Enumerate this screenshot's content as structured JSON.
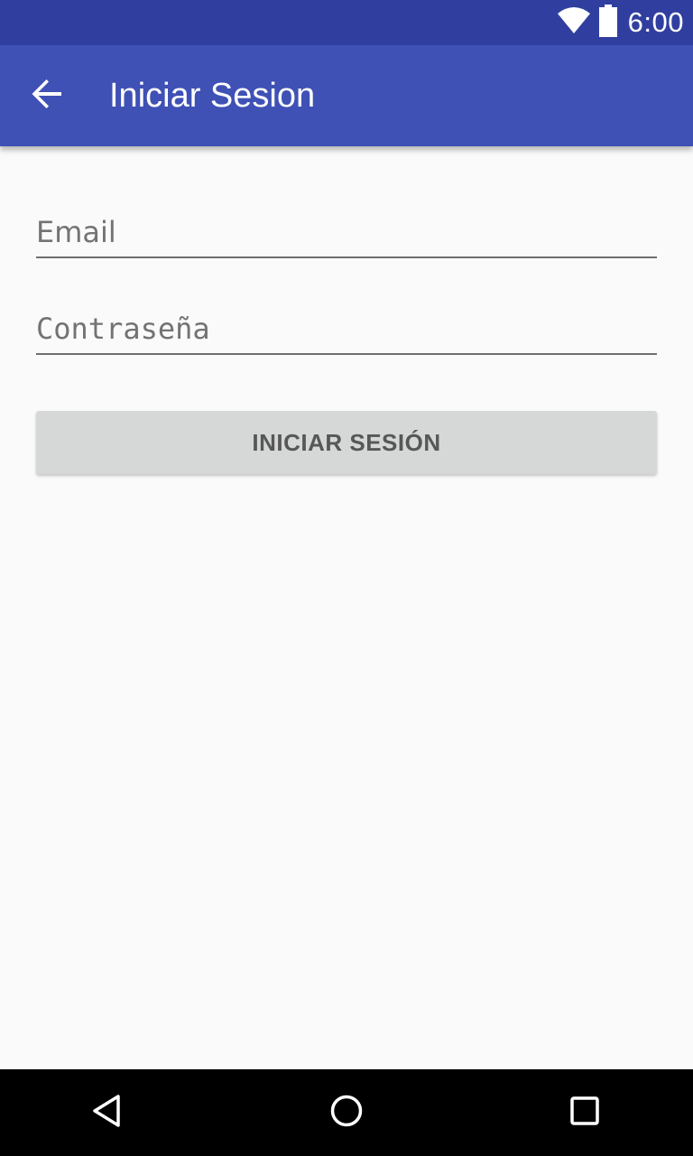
{
  "status_bar": {
    "time": "6:00",
    "icons": [
      "wifi-icon",
      "battery-icon"
    ]
  },
  "app_bar": {
    "title": "Iniciar Sesion",
    "back_icon": "arrow-back-icon"
  },
  "form": {
    "email_placeholder": "Email",
    "email_value": "",
    "password_placeholder": "Contraseña",
    "password_value": "",
    "submit_label": "INICIAR SESIÓN"
  },
  "nav_bar": {
    "icons": [
      "nav-back-icon",
      "nav-home-icon",
      "nav-recents-icon"
    ]
  },
  "colors": {
    "status_bar": "#303f9f",
    "app_bar": "#3f51b5",
    "background": "#fafafa",
    "button": "#d6d7d7",
    "nav_bar": "#000000"
  }
}
